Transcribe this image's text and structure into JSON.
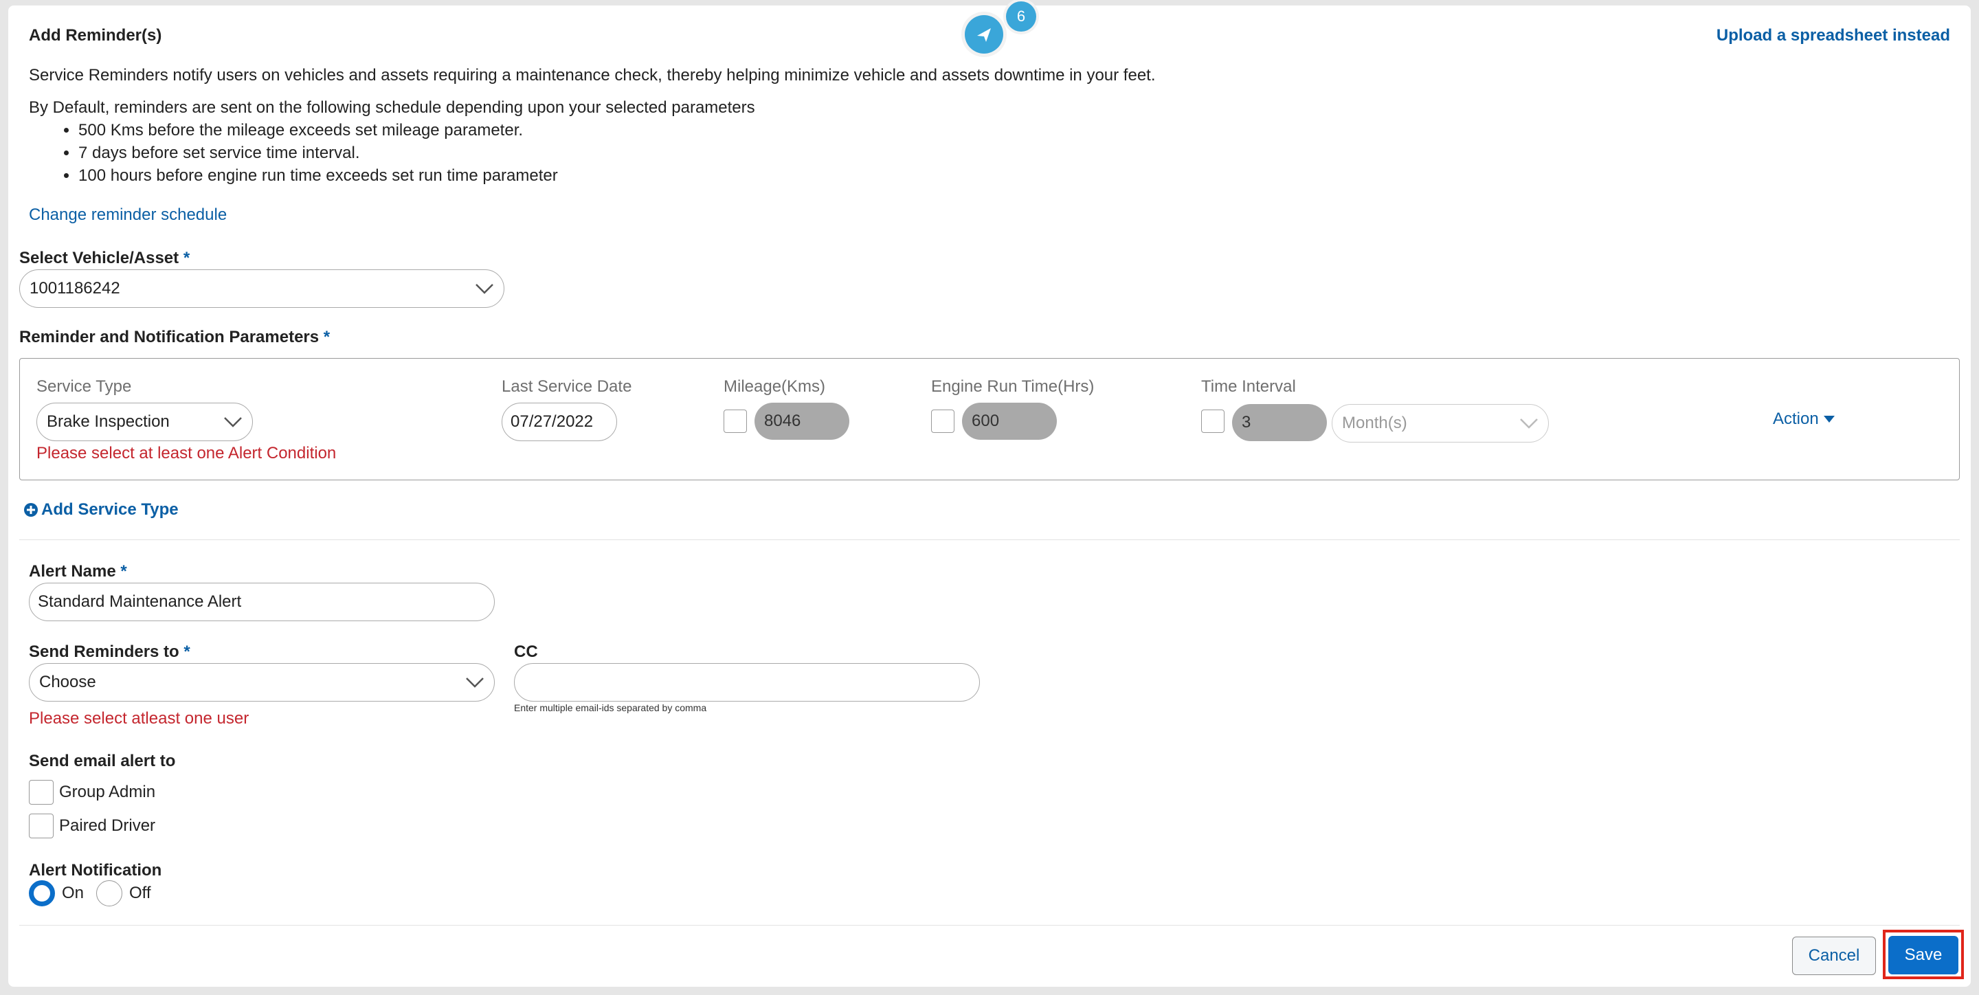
{
  "header": {
    "title": "Add Reminder(s)",
    "upload_link": "Upload a spreadsheet instead",
    "badge_count": "6"
  },
  "intro": {
    "description": "Service Reminders notify users on vehicles and assets requiring a maintenance check, thereby helping minimize vehicle and assets downtime in your feet.",
    "default_schedule": "By Default, reminders are sent on the following schedule depending upon your selected parameters",
    "bullets": [
      "500 Kms before the mileage exceeds set mileage parameter.",
      "7 days before set service time interval.",
      "100 hours before engine run time exceeds set run time parameter"
    ],
    "change_schedule_link": "Change reminder schedule"
  },
  "vehicle": {
    "label": "Select Vehicle/Asset",
    "required_mark": "*",
    "value": "1001186242"
  },
  "params": {
    "label": "Reminder and Notification Parameters",
    "required_mark": "*",
    "columns": {
      "service_type": "Service Type",
      "last_service_date": "Last Service Date",
      "mileage": "Mileage(Kms)",
      "engine_run_time": "Engine Run Time(Hrs)",
      "time_interval": "Time Interval"
    },
    "row": {
      "service_type": "Brake Inspection",
      "last_service_date": "07/27/2022",
      "mileage": "8046",
      "engine_run_time": "600",
      "time_interval": "3",
      "time_unit": "Month(s)",
      "action": "Action"
    },
    "error": "Please select at least one Alert Condition",
    "add_service_type": "Add Service Type"
  },
  "alert_name": {
    "label": "Alert Name",
    "required_mark": "*",
    "value": "Standard Maintenance Alert"
  },
  "send_reminders": {
    "label": "Send Reminders to",
    "required_mark": "*",
    "value": "Choose",
    "error": "Please select atleast one user"
  },
  "cc": {
    "label": "CC",
    "value": "",
    "hint": "Enter multiple email-ids separated by comma"
  },
  "email_alert": {
    "label": "Send email alert to",
    "options": [
      "Group Admin",
      "Paired Driver"
    ]
  },
  "alert_notification": {
    "label": "Alert Notification",
    "on_label": "On",
    "off_label": "Off",
    "selected": "On"
  },
  "footer": {
    "cancel_label": "Cancel",
    "save_label": "Save"
  },
  "colors": {
    "primary": "#0b6ec9",
    "link": "#0b5fa5",
    "error": "#c4262e",
    "badge": "#3aa6d9",
    "highlight": "#e0261a"
  }
}
